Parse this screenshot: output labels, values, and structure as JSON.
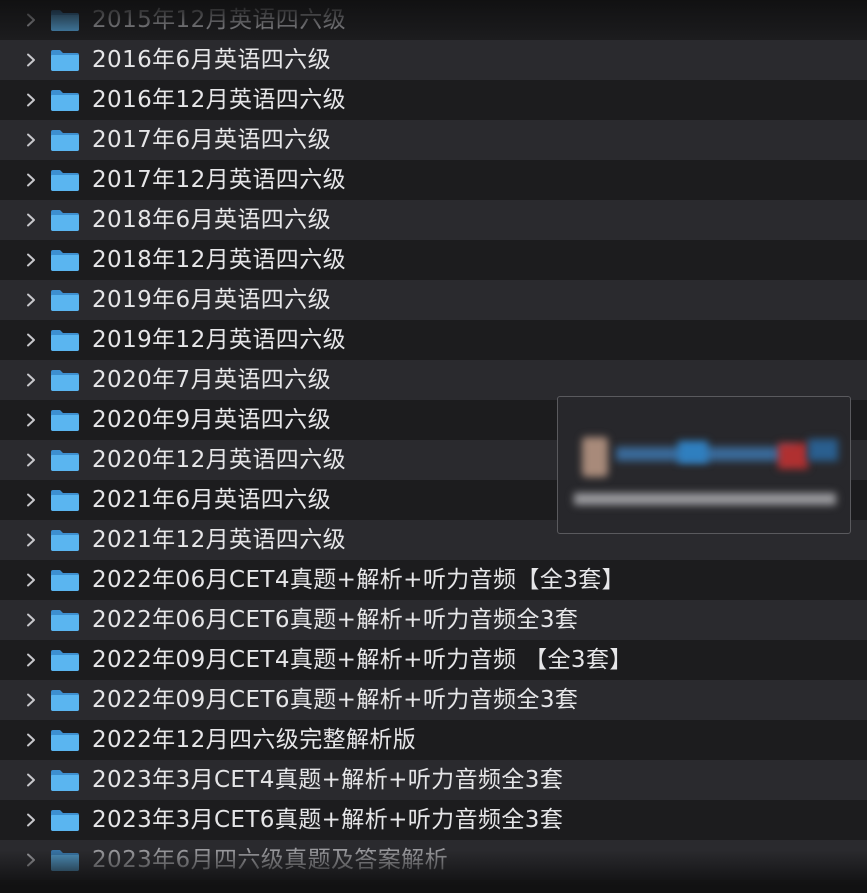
{
  "folders": [
    {
      "label": "2015年12月英语四六级"
    },
    {
      "label": "2016年6月英语四六级"
    },
    {
      "label": "2016年12月英语四六级"
    },
    {
      "label": "2017年6月英语四六级"
    },
    {
      "label": "2017年12月英语四六级"
    },
    {
      "label": "2018年6月英语四六级"
    },
    {
      "label": "2018年12月英语四六级"
    },
    {
      "label": "2019年6月英语四六级"
    },
    {
      "label": "2019年12月英语四六级"
    },
    {
      "label": "2020年7月英语四六级"
    },
    {
      "label": "2020年9月英语四六级"
    },
    {
      "label": "2020年12月英语四六级"
    },
    {
      "label": "2021年6月英语四六级"
    },
    {
      "label": "2021年12月英语四六级"
    },
    {
      "label": "2022年06月CET4真题+解析+听力音频【全3套】"
    },
    {
      "label": "2022年06月CET6真题+解析+听力音频全3套"
    },
    {
      "label": "2022年09月CET4真题+解析+听力音频 【全3套】"
    },
    {
      "label": "2022年09月CET6真题+解析+听力音频全3套"
    },
    {
      "label": "2022年12月四六级完整解析版"
    },
    {
      "label": "2023年3月CET4真题+解析+听力音频全3套"
    },
    {
      "label": "2023年3月CET6真题+解析+听力音频全3套"
    },
    {
      "label": "2023年6月四六级真题及答案解析"
    }
  ],
  "icons": {
    "row_expander": "chevron-right-icon",
    "row_folder": "folder-icon"
  },
  "colors": {
    "folder_blue": "#4aa8e8",
    "row_alt": "#2a2a2e",
    "row_plain": "#1c1c1e",
    "text": "#e6e6e8"
  }
}
